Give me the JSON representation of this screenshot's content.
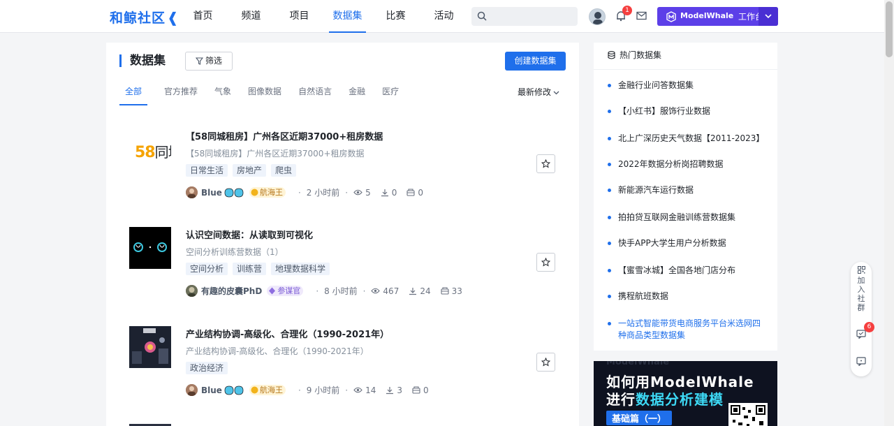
{
  "header": {
    "logo": "和鲸社区",
    "nav": [
      "首页",
      "频道",
      "项目",
      "数据集",
      "比赛",
      "活动"
    ],
    "active_nav": "数据集",
    "search_placeholder": "",
    "notification_count": "1",
    "mw_brand": "ModelWhale",
    "mw_dot": "·",
    "mw_workspace": "工作台"
  },
  "main": {
    "title": "数据集",
    "filter_label": "筛选",
    "create_label": "创建数据集",
    "tabs": [
      "全部",
      "官方推荐",
      "气象",
      "图像数据",
      "自然语言",
      "金融",
      "医疗"
    ],
    "sort_label": "最新修改",
    "items": [
      {
        "title": "【58同城租房】广州各区近期37000+租房数据",
        "subtitle": "【58同城租房】广州各区近期37000+租房数据",
        "tags": [
          "日常生活",
          "房地产",
          "爬虫"
        ],
        "user": "Blue",
        "rank": "航海王",
        "time": "2 小时前",
        "views": "5",
        "downloads": "0",
        "forks": "0",
        "thumb_text": [
          "58",
          "同城"
        ]
      },
      {
        "title": "认识空间数据：从读取到可视化",
        "subtitle": "空间分析训练营数据（1）",
        "tags": [
          "空间分析",
          "训练营",
          "地理数据科学"
        ],
        "user": "有趣的皮囊PhD",
        "rank": "参谋官",
        "time": "8 小时前",
        "views": "467",
        "downloads": "24",
        "forks": "33"
      },
      {
        "title": "产业结构协调-高级化、合理化（1990-2021年）",
        "subtitle": "产业结构协调-高级化、合理化（1990-2021年）",
        "tags": [
          "政治经济"
        ],
        "user": "Blue",
        "rank": "航海王",
        "time": "9 小时前",
        "views": "14",
        "downloads": "3",
        "forks": "0"
      }
    ]
  },
  "sidebar": {
    "hot_title": "热门数据集",
    "hot_items": [
      "金融行业问答数据集",
      "【小红书】服饰行业数据",
      "北上广深历史天气数据【2011-2023】",
      "2022年数据分析岗招聘数据",
      "新能源汽车运行数据",
      "拍拍贷互联网金融训练营数据集",
      "快手APP大学生用户分析数据",
      "【蜜雪冰城】全国各地门店分布",
      "携程航班数据",
      "一站式智能带货电商服务平台米选网四种商品类型数据集"
    ],
    "banner": {
      "watermark": "ModelWhale",
      "line1": "如何用ModelWhale",
      "line2_a": "进行",
      "line2_b": "数据分析建模",
      "line3": "基础篇（一）"
    }
  },
  "float_tools": {
    "join_label": "加入社群",
    "message_count": "6"
  },
  "colors": {
    "primary": "#1f6feb",
    "modelwhale": "#5c3fe8",
    "badge": "#f53f3f"
  }
}
